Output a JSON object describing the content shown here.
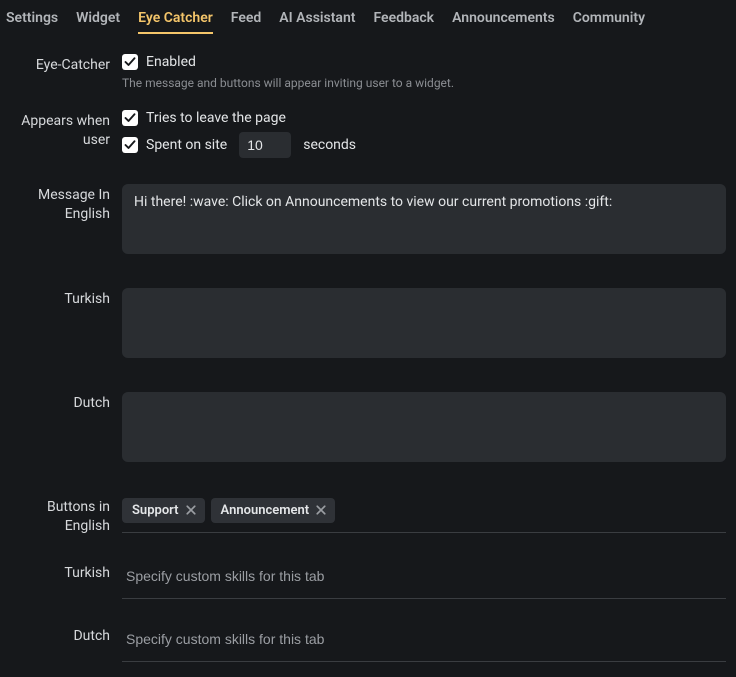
{
  "tabs": [
    {
      "label": "Settings"
    },
    {
      "label": "Widget"
    },
    {
      "label": "Eye Catcher",
      "active": true
    },
    {
      "label": "Feed"
    },
    {
      "label": "AI Assistant"
    },
    {
      "label": "Feedback"
    },
    {
      "label": "Announcements"
    },
    {
      "label": "Community"
    }
  ],
  "eyeCatcher": {
    "label": "Eye-Catcher",
    "enabled_label": "Enabled",
    "helptext": "The message and buttons will appear inviting user to a widget."
  },
  "appears": {
    "label": "Appears when user",
    "leave_label": "Tries to leave the page",
    "spent_prefix": "Spent on site",
    "spent_value": "10",
    "spent_suffix": "seconds"
  },
  "messages": {
    "english_label": "Message In English",
    "english_value": "Hi there! :wave: Click on Announcements to view our current promotions :gift:",
    "turkish_label": "Turkish",
    "turkish_value": "",
    "dutch_label": "Dutch",
    "dutch_value": ""
  },
  "buttons": {
    "english_label": "Buttons in English",
    "english_tags": [
      "Support",
      "Announcement"
    ],
    "turkish_label": "Turkish",
    "turkish_placeholder": "Specify custom skills for this tab",
    "dutch_label": "Dutch",
    "dutch_placeholder": "Specify custom skills for this tab"
  }
}
